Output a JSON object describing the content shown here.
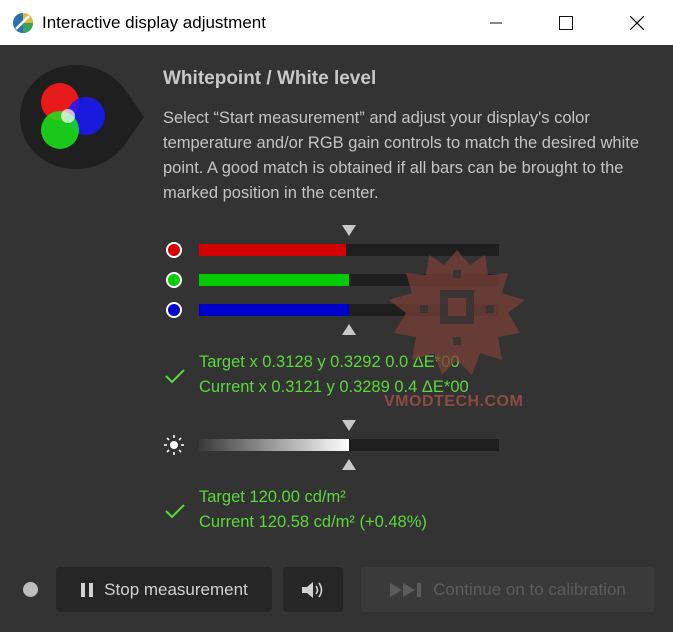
{
  "window": {
    "title": "Interactive display adjustment",
    "controls": {
      "minimize": "minimize-icon",
      "maximize": "maximize-icon",
      "close": "close-icon"
    }
  },
  "header": {
    "heading": "Whitepoint / White level",
    "description": "Select “Start measurement” and adjust your display's color temperature and/or RGB gain controls to match the desired white point. A good match is obtained if all bars can be brought to the marked position in the center."
  },
  "rgb_bars": [
    {
      "channel": "red",
      "color": "#d30000",
      "level": 0.49
    },
    {
      "channel": "green",
      "color": "#00cc00",
      "level": 0.5
    },
    {
      "channel": "blue",
      "color": "#0000cc",
      "level": 0.5
    }
  ],
  "whitepoint": {
    "target": "Target x 0.3128 y 0.3292 0.0 ΔE*00",
    "current": "Current x 0.3121 y 0.3289 0.4 ΔE*00"
  },
  "luminance": {
    "level": 0.5,
    "target": "Target 120.00 cd/m²",
    "current": "Current 120.58 cd/m² (+0.48%)"
  },
  "footer": {
    "stop_label": "Stop measurement",
    "continue_label": "Continue on to calibration"
  },
  "watermark": {
    "text": "VMODTECH.COM"
  },
  "colors": {
    "background": "#333333",
    "accent_green": "#5bd83b",
    "text": "#c4c4c4"
  }
}
